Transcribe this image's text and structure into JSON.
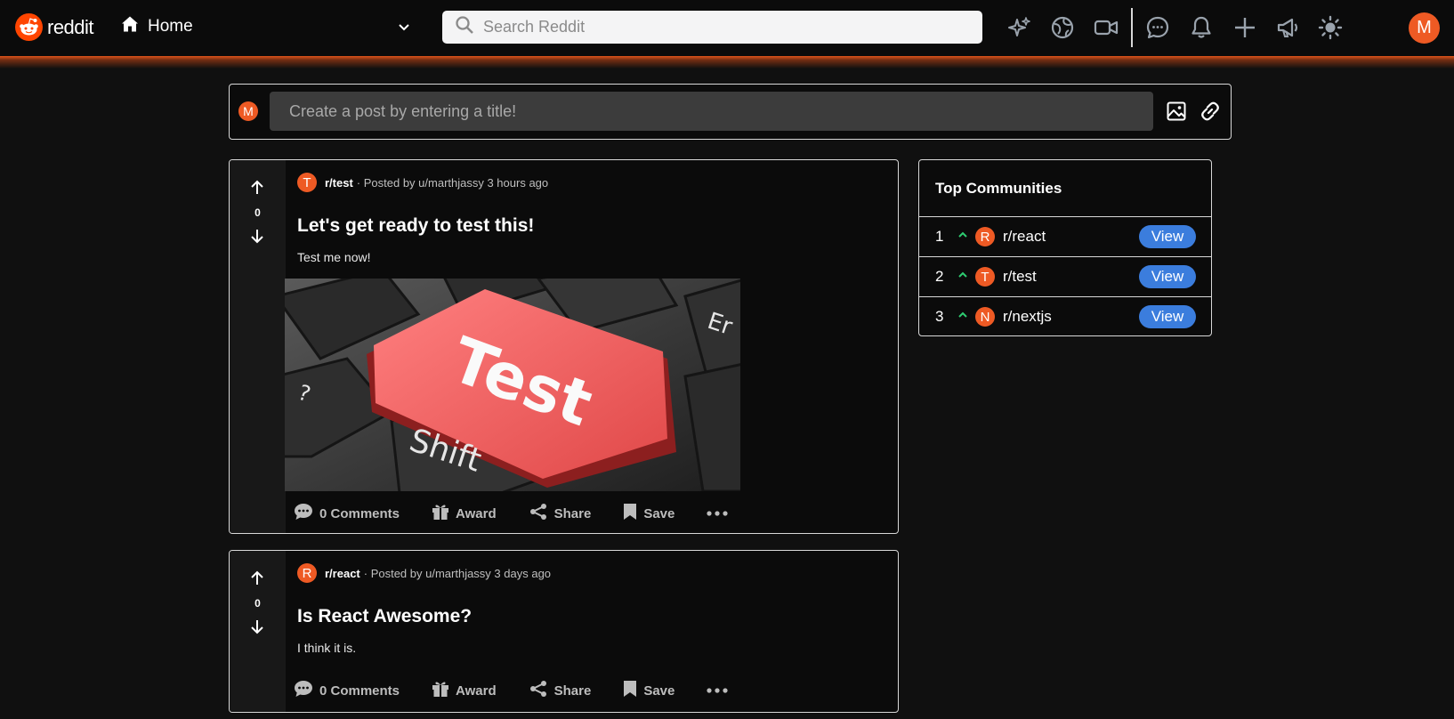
{
  "nav": {
    "brand": "reddit",
    "home_label": "Home",
    "search_placeholder": "Search Reddit",
    "user_initial": "M",
    "icons": [
      "sparkles-icon",
      "globe-icon",
      "video-icon",
      "chat-icon",
      "bell-icon",
      "plus-icon",
      "megaphone-icon",
      "sun-icon"
    ],
    "accent": "#ff4500"
  },
  "create_post": {
    "user_initial": "M",
    "placeholder": "Create a post by entering a title!"
  },
  "posts": [
    {
      "community_initial": "T",
      "community": "r/test",
      "meta": "· Posted by u/marthjassy 3 hours ago",
      "votes": "0",
      "title": "Let's get ready to test this!",
      "body": "Test me now!",
      "image": {
        "key_label": "Test",
        "shift_label": "Shift"
      },
      "actions": {
        "comments": "0 Comments",
        "award": "Award",
        "share": "Share",
        "save": "Save"
      }
    },
    {
      "community_initial": "R",
      "community": "r/react",
      "meta": "· Posted by u/marthjassy 3 days ago",
      "votes": "0",
      "title": "Is React Awesome?",
      "body": "I think it is.",
      "actions": {
        "comments": "0 Comments",
        "award": "Award",
        "share": "Share",
        "save": "Save"
      }
    }
  ],
  "sidebar": {
    "title": "Top Communities",
    "communities": [
      {
        "rank": "1",
        "initial": "R",
        "name": "r/react",
        "button": "View"
      },
      {
        "rank": "2",
        "initial": "T",
        "name": "r/test",
        "button": "View"
      },
      {
        "rank": "3",
        "initial": "N",
        "name": "r/nextjs",
        "button": "View"
      }
    ],
    "caret_color": "#2ecc71",
    "button_color": "#3b7ddd"
  }
}
